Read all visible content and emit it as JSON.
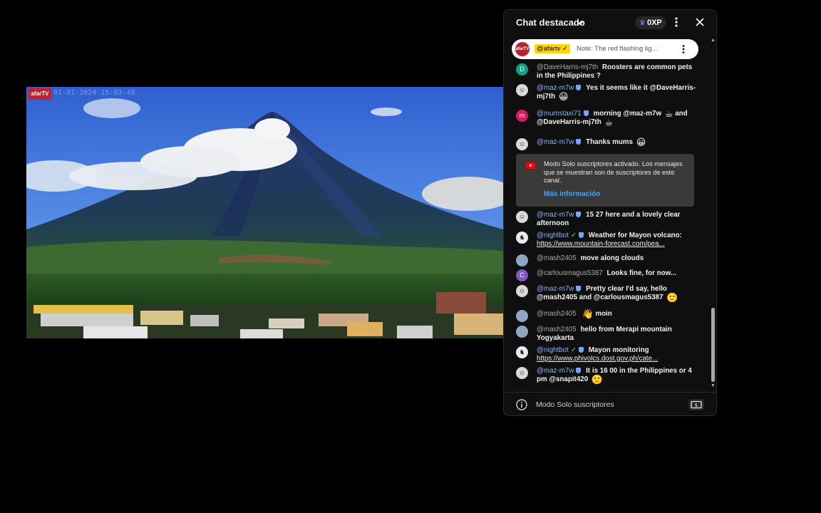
{
  "video": {
    "logo": "afarTV",
    "timestamp": "01-01-2024 15:03:48"
  },
  "chat": {
    "title": "Chat destacado",
    "xp": "0XP",
    "pinned": {
      "avatar_text": "afarTV",
      "author": "@afartv ✓",
      "text": "Note: The red flashing lig..."
    },
    "messages": [
      {
        "avatar": "D",
        "author": "@DaveHarris-mj7th",
        "text": "Roosters are common pets in the Philippines ?"
      },
      {
        "avatar": "",
        "author": "@maz-m7w",
        "text": "Yes it seems like it @DaveHarris-mj7th",
        "emoji": "😀"
      },
      {
        "avatar": "m",
        "author": "@mumstaxi71",
        "text": "morning @maz-m7w",
        "emoji": "☕",
        "text2": "and @DaveHarris-mj7th",
        "emoji2": "☕"
      },
      {
        "avatar": "",
        "author": "@maz-m7w",
        "text": "Thanks mums",
        "emoji": "😀"
      },
      {
        "avatar": "",
        "author": "@maz-m7w",
        "text": "15 27 here and a lovely clear afternoon"
      },
      {
        "avatar": "",
        "author": "@nightbot",
        "text": "Weather for Mayon volcano:",
        "link": "https://www.mountain-forecast.com/pea..."
      },
      {
        "avatar": "",
        "author": "@mash2405",
        "text": "move along clouds"
      },
      {
        "avatar": "C",
        "author": "@carlousmagus5387",
        "text": "Looks fine, for now..."
      },
      {
        "avatar": "",
        "author": "@maz-m7w",
        "text": "Pretty clear I'd say, hello @mash2405 and @carlousmagus5387",
        "emoji": "🙂"
      },
      {
        "avatar": "",
        "author": "@mash2405",
        "emoji": "👋",
        "text": "moin"
      },
      {
        "avatar": "",
        "author": "@mash2405",
        "text": "hello from Merapi mountain Yogyakarta"
      },
      {
        "avatar": "",
        "author": "@nightbot",
        "text": "Mayon monitoring",
        "link": "https://www.phivolcs.dost.gov.ph/cate..."
      },
      {
        "avatar": "",
        "author": "@maz-m7w",
        "text": "It is 16 00 in the Philippines or 4 pm @snapit420",
        "emoji": "🙂"
      }
    ],
    "notice": {
      "text": "Modo Solo suscriptores activado. Los mensajes que se muestran son de suscriptores de este canal.",
      "link": "Más información"
    },
    "footer": {
      "text": "Modo Solo suscriptores"
    },
    "colors": {
      "link_blue": "#3ea6ff",
      "author_blue": "#8ab4f8",
      "pinned_highlight": "#ffd600"
    }
  }
}
